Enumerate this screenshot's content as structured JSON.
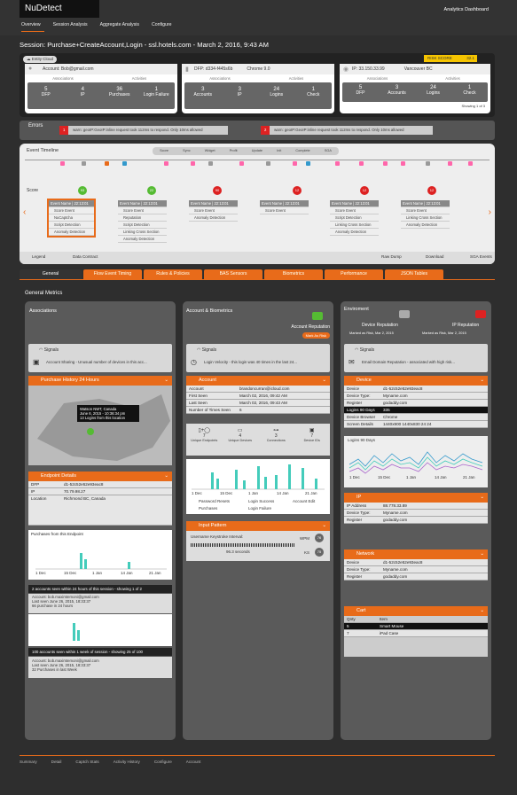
{
  "app": {
    "name": "NuDetect",
    "dashboard": "Analytics Dashboard"
  },
  "nav": [
    "Overview",
    "Session Analysis",
    "Aggregate Analysis",
    "Configure"
  ],
  "session": {
    "title": "Session: Purchase+CreateAccount,Login - ssl.hotels.com - March 2, 2016, 9:43 AM",
    "entity": "Entity Cloud"
  },
  "risk": {
    "label": "RISK SCORE",
    "value": "32.1"
  },
  "account": {
    "label": "Account: Bob@gmail.com",
    "assoc": "Associations",
    "acts": "Activities",
    "stats": [
      [
        "5",
        "DFP"
      ],
      [
        "4",
        "IP"
      ],
      [
        "36",
        "Purchases"
      ],
      [
        "1",
        "Login Failure"
      ]
    ]
  },
  "dfp": {
    "label": "DFP: d334-f445s6b",
    "browser": "Chrome 9.0",
    "assoc": "Associations",
    "acts": "Activities",
    "stats": [
      [
        "3",
        "Accounts"
      ],
      [
        "3",
        "IP"
      ],
      [
        "24",
        "Logins"
      ],
      [
        "1",
        "Check"
      ]
    ]
  },
  "ip": {
    "label": "IP: 33.150.33.99",
    "location": "Vancouver BC",
    "assoc": "Associations",
    "acts": "Activities",
    "stats": [
      [
        "5",
        "DFP"
      ],
      [
        "3",
        "Accounts"
      ],
      [
        "24",
        "Logins"
      ],
      [
        "1",
        "Check"
      ]
    ],
    "paging": "Showing 1 of 3"
  },
  "errors": {
    "title": "Errors",
    "items": [
      {
        "n": "1",
        "text": "warn: geoIP:GeoIP:inline request took 112ms to respond. Only 10ms allowed"
      },
      {
        "n": "2",
        "text": "warn: geoIP:GeoIP:inline request took 112ms to respond. Only 10ms allowed"
      }
    ]
  },
  "timeline": {
    "title": "Event Timeline",
    "legend_items": [
      "Score",
      "Sync",
      "Widget",
      "Profit",
      "Update",
      "Init",
      "Complete",
      "SGA"
    ],
    "score": "Score",
    "scores": [
      "93",
      "22",
      "90",
      "12",
      "12",
      "12"
    ],
    "events": [
      {
        "head": "Event Name | 22:13:01",
        "rows": [
          "Score Event",
          "NuCaptcha",
          "Script Detection",
          "Anomaly Detection"
        ]
      },
      {
        "head": "Event Name | 22:13:01",
        "rows": [
          "Score Event",
          "Reputation",
          "Script Detection",
          "Linking Cross Section",
          "Anomaly Detection"
        ]
      },
      {
        "head": "Event Name | 22:13:01",
        "rows": [
          "Score Event",
          "Anomaly Detection"
        ]
      },
      {
        "head": "Event Name | 22:13:01",
        "rows": [
          "Score Event"
        ]
      },
      {
        "head": "Event Name | 22:13:01",
        "rows": [
          "Score Event",
          "Script Detection",
          "Linking Cross Section",
          "Anomaly Detection"
        ]
      },
      {
        "head": "Event Name | 22:13:01",
        "rows": [
          "Score Event",
          "Linking Cross Section",
          "Anomaly Detection"
        ]
      }
    ],
    "legend": "Legend",
    "data_contract": "Data Contract",
    "raw_dump": "Raw Dump",
    "download": "Download",
    "sga_events": "SGA Events"
  },
  "tabs": [
    "General",
    "Flow Event Timing",
    "Rules & Policies",
    "BAS Sensors",
    "Biometrics",
    "Performance",
    "JSON Tables"
  ],
  "general_metrics": "General Metrics",
  "col1": {
    "title": "Associations",
    "signals": "Signals",
    "sharing": "Account Sharing - Unusual number of devices in this acc...",
    "history": "Purchase History 24 Hours",
    "map_tip": [
      "Watson NWT, Canada",
      "June 6, 2015 - 10:36:34 pm",
      "13 Logins from this location"
    ],
    "endpoint": "Endpoint Details",
    "ep_rows": [
      [
        "DFP",
        "d1-52c52e52e93eac8"
      ],
      [
        "IP",
        "70.79.98.27"
      ],
      [
        "Location",
        "Richmond BC, Canada"
      ]
    ],
    "purchases": "Purchases from this Endpoint",
    "xlabels": [
      "1 Dec",
      "15 Dec",
      "1 Jan",
      "14 Jan",
      "21 Jan"
    ],
    "accts24": "2 accounts seen within 24 hours of this session - showing 1 of 2",
    "acct1": [
      "Account: bob.maximtemoni@gmail.com",
      "Last seen June 26, 2015, 18:33:37",
      "66 purchase in 24 hours"
    ],
    "accts1w": "100 accounts seen within 1 week of session - showing 25 of 100",
    "acct2": [
      "Account: bob.maximtemoni@gmail.com",
      "Last seen June 26, 2015, 18:33:37",
      "32 Purchases in last Week"
    ]
  },
  "col2": {
    "title": "Account & Biometrics",
    "rep": "Account Reputation",
    "mark": "Mark As Risk",
    "signals": "Signals",
    "velocity": "Login Velocity - this login was 40 times in the last 24...",
    "account": "Account",
    "acc_rows": [
      [
        "Account",
        "brandoncurran@icloud.com"
      ],
      [
        "First Seen",
        "March 02, 2016, 09:42 AM"
      ],
      [
        "Last Seen",
        "March 02, 2016, 09:43 AM"
      ],
      [
        "Number of Times Seen",
        "6"
      ]
    ],
    "icons": [
      [
        "7",
        "Unique Endpoints"
      ],
      [
        "4",
        "Unique Devices"
      ],
      [
        "3",
        "Connections"
      ],
      [
        "7",
        "Device IDs"
      ]
    ],
    "xlabels": [
      "1 Dec",
      "15 Dec",
      "1 Jan",
      "14 Jan",
      "21 Jan"
    ],
    "legend": [
      "Password Resets",
      "Login Success",
      "Account Edit",
      "Purchases",
      "Login Failure"
    ],
    "input": "Input Pattern",
    "keystroke": "Username Keystroke Interval:",
    "seconds": "96.3 seconds",
    "wpm": "WPM",
    "wpm_v": "76",
    "ks": "KS",
    "ks_v": "75"
  },
  "col3": {
    "title": "Enviroment",
    "dev_rep": "Device Reputation",
    "ip_rep": "IP Reputation",
    "dev_mark": "Marked as Risk, Mar 2, 2015",
    "ip_mark": "Marked as Risk, Mar 2, 2015",
    "signals": "Signals",
    "email": "Email Domain Reputation - associated with high risk...",
    "device": "Device",
    "dev_rows": [
      [
        "Device",
        "d1-52c52e52e93eac8"
      ],
      [
        "Device Type:",
        "Myname.com"
      ],
      [
        "Register",
        "godaddy.com"
      ],
      [
        "Logins 90 Days",
        "335"
      ],
      [
        "Device Browser",
        "Chrome"
      ],
      [
        "Screen Details",
        "1440x900 1440x830 24 24"
      ]
    ],
    "logins90": "Logins 90 Days",
    "xlabels": [
      "1 Dec",
      "15 Dec",
      "1 Jan",
      "14 Jan",
      "21 Jan"
    ],
    "ip": "IP",
    "ip_rows": [
      [
        "IP Address",
        "88.778.33.89"
      ],
      [
        "Device Type:",
        "Myname.com"
      ],
      [
        "Register",
        "godaddy.com"
      ]
    ],
    "network": "Network",
    "net_rows": [
      [
        "Device",
        "d1-52c52e52e93eac8"
      ],
      [
        "Device Type:",
        "Myname.com"
      ],
      [
        "Register",
        "godaddy.com"
      ]
    ],
    "cart": "Cart",
    "cart_head": [
      "Qnty",
      "Item"
    ],
    "cart_rows": [
      [
        "5",
        "Smart Mouse"
      ],
      [
        "7",
        "iPad Case"
      ]
    ]
  },
  "footer": [
    "Summary",
    "Detail",
    "Captch Stats",
    "Activity History",
    "Configure",
    "Account"
  ]
}
